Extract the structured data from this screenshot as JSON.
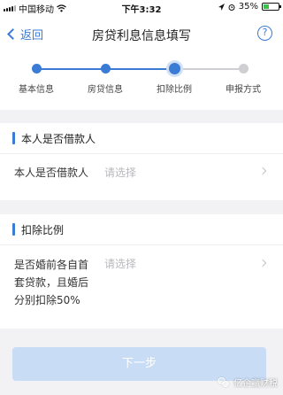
{
  "status_bar": {
    "carrier": "中国移动",
    "time": "下午3:32",
    "battery": "35%",
    "battery_level": 0.35,
    "battery_color": "#3bc14a"
  },
  "navbar": {
    "back_label": "返回",
    "title": "房贷利息信息填写",
    "help_label": "?"
  },
  "steps": {
    "items": [
      {
        "label": "基本信息",
        "state": "done"
      },
      {
        "label": "房贷信息",
        "state": "done"
      },
      {
        "label": "扣除比例",
        "state": "current"
      },
      {
        "label": "申报方式",
        "state": "pending"
      }
    ],
    "active_color": "#3a7bd5",
    "inactive_color": "#cfcfd3"
  },
  "section_borrower": {
    "title": "本人是否借款人",
    "row_label": "本人是否借款人",
    "row_placeholder": "请选择"
  },
  "section_ratio": {
    "title": "扣除比例",
    "row_label": "是否婚前各自首套贷款，且婚后分别扣除50%",
    "row_placeholder": "请选择"
  },
  "next_button": "下一步",
  "watermark": "亿企赢财税",
  "colors": {
    "accent": "#3a7bd5",
    "button_disabled": "#c8dcf6",
    "background": "#f2f2f4"
  }
}
